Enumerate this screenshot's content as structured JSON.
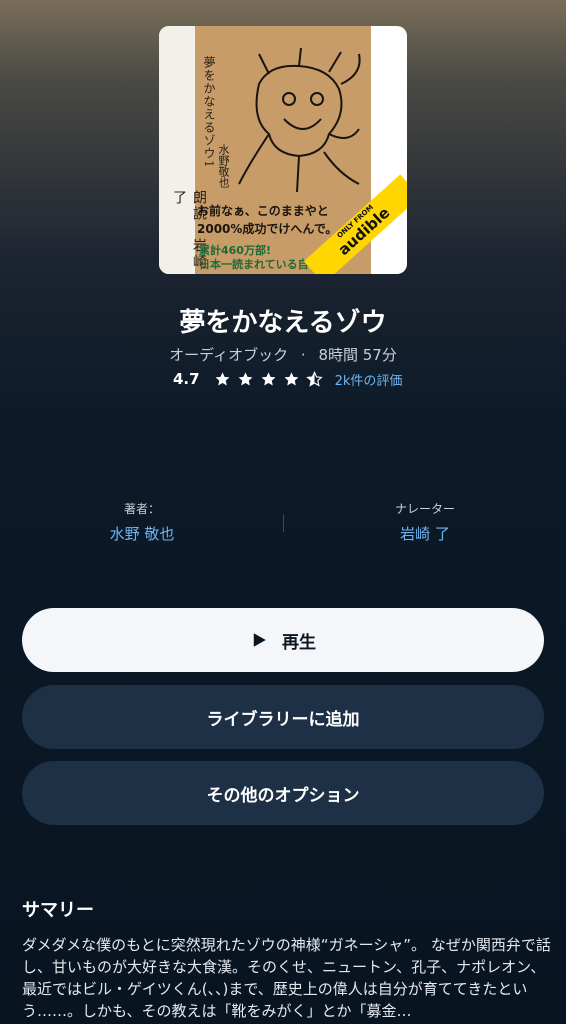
{
  "book": {
    "cover": {
      "title_vertical": "夢をかなえるゾウ1",
      "author_vertical": "水野敬也",
      "narrator_vertical": "朗読　岩崎了",
      "slogan_line1": "お前なぁ、このままやと",
      "slogan_line2": "2000%成功でけへんで。",
      "sales_line1": "累計460万部!",
      "sales_line2": "日本一読まれている自己",
      "badge_small": "ONLY FROM",
      "badge_big": "audible"
    },
    "title": "夢をかなえるゾウ",
    "format": "オーディオブック",
    "separator": "·",
    "duration": "8時間 57分",
    "rating_value": "4.7",
    "stars": 4.5,
    "rating_count": "2k件の評価"
  },
  "credits": {
    "author_label": "著者：",
    "author_name": "水野 敬也",
    "narrator_label": "ナレーター",
    "narrator_name": "岩崎 了"
  },
  "actions": {
    "play_label": "再生",
    "add_library_label": "ライブラリーに追加",
    "more_options_label": "その他のオプション"
  },
  "summary": {
    "heading": "サマリー",
    "text": "ダメダメな僕のもとに突然現れたゾウの神様“ガネーシャ”。 なぜか関西弁で話し、甘いものが大好きな大食漢。そのくせ、ニュートン、孔子、ナポレオン、最近ではビル・ゲイツくん(、、)まで、歴史上の偉人は自分が育ててきたという……。しかも、その教えは「靴をみがく」とか「募金…"
  },
  "colors": {
    "accent_blue": "#6fb4ef",
    "play_button_bg": "#f4f6fa",
    "dark_button_bg": "#1e3046",
    "badge_yellow": "#ffd600"
  }
}
